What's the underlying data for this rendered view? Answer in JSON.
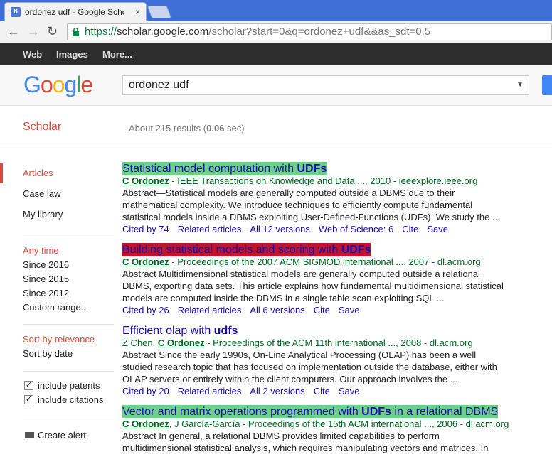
{
  "browser": {
    "tab_title": "ordonez udf - Google Scho",
    "tab_close": "×",
    "url_https": "https://",
    "url_host": "scholar.google.com",
    "url_path": "/scholar?start=0&q=ordonez+udf&&as_sdt=0,5"
  },
  "gbar": {
    "web": "Web",
    "images": "Images",
    "more": "More..."
  },
  "header": {
    "logo_letters": [
      "G",
      "o",
      "o",
      "g",
      "l",
      "e"
    ],
    "logo_colors": [
      "#4285f4",
      "#ea4335",
      "#fbbc05",
      "#4285f4",
      "#34a853",
      "#ea4335"
    ],
    "search_value": "ordonez udf",
    "dropdown_glyph": "▼"
  },
  "subhead": {
    "scholar": "Scholar",
    "results_prefix": "About 215 results (",
    "results_time": "0.06",
    "results_suffix": " sec)"
  },
  "sidebar": {
    "articles": "Articles",
    "case_law": "Case law",
    "my_library": "My library",
    "any_time": "Any time",
    "since_2016": "Since 2016",
    "since_2015": "Since 2015",
    "since_2012": "Since 2012",
    "custom_range": "Custom range...",
    "sort_relevance": "Sort by relevance",
    "sort_date": "Sort by date",
    "include_patents": "include patents",
    "include_citations": "include citations",
    "checkmark": "✓",
    "create_alert": "Create alert"
  },
  "results": [
    {
      "title_pre": "Statistical model computation with ",
      "title_bold": "UDFs",
      "title_post": "",
      "author_pre": "",
      "author_bold": "C Ordonez",
      "meta": " - IEEE Transactions on Knowledge and Data ..., 2010 - ieeexplore.ieee.org",
      "snippet": "Abstract—Statistical models are generally computed outside a DBMS due to their mathematical complexity. We introduce techniques to efficiently compute fundamental statistical models inside a DBMS exploiting User-Defined-Functions (UDFs). We study the ...",
      "links": [
        "Cited by 74",
        "Related articles",
        "All 12 versions",
        "Web of Science: 6",
        "Cite",
        "Save"
      ]
    },
    {
      "title_pre": "Building statistical models and scoring with ",
      "title_bold": "UDFs",
      "title_post": "",
      "author_pre": "",
      "author_bold": "C Ordonez",
      "meta": " - Proceedings of the 2007 ACM SIGMOD international ..., 2007 - dl.acm.org",
      "snippet": "Abstract Multidimensional statistical models are generally computed outside a relational DBMS, exporting data sets. This article explains how fundamental multidimensional statistical models are computed inside the DBMS in a single table scan exploiting SQL ...",
      "links": [
        "Cited by 26",
        "Related articles",
        "All 6 versions",
        "Cite",
        "Save"
      ]
    },
    {
      "title_pre": "Efficient olap with ",
      "title_bold": "udfs",
      "title_post": "",
      "author_pre": "Z Chen, ",
      "author_bold": "C Ordonez",
      "meta": " - Proceedings of the ACM 11th international ..., 2008 - dl.acm.org",
      "snippet": "Abstract Since the early 1990s, On-Line Analytical Processing (OLAP) has been a well studied research topic that has focused on implementation outside the database, either with OLAP servers or entirely within the client computers. Our approach involves the ...",
      "links": [
        "Cited by 20",
        "Related articles",
        "All 2 versions",
        "Cite",
        "Save"
      ]
    },
    {
      "title_pre": "Vector and matrix operations programmed with ",
      "title_bold": "UDFs",
      "title_post": " in a relational DBMS",
      "author_pre": "",
      "author_bold": "C Ordonez",
      "meta": ", J García-García - Proceedings of the 15th ACM international ..., 2006 - dl.acm.org",
      "snippet": "Abstract In general, a relational DBMS provides limited capabilities to perform multidimensional statistical analysis, which requires manipulating vectors and matrices. In",
      "links": []
    }
  ]
}
